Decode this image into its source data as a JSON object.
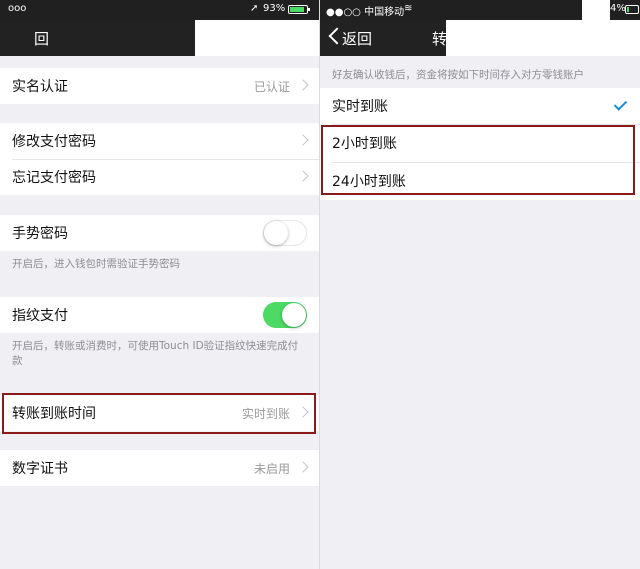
{
  "left": {
    "status": {
      "carrier": "ooo",
      "battery": "93%"
    },
    "nav": {
      "back_label": "回"
    },
    "rows": {
      "realname": {
        "title": "实名认证",
        "value": "已认证"
      },
      "change_pwd": {
        "title": "修改支付密码"
      },
      "forgot_pwd": {
        "title": "忘记支付密码"
      },
      "gesture": {
        "title": "手势密码",
        "on": false,
        "note": "开启后，进入钱包时需验证手势密码"
      },
      "fingerprint": {
        "title": "指纹支付",
        "on": true,
        "note": "开启后，转账或消费时，可使用Touch ID验证指纹快速完成付款"
      },
      "transfer_time": {
        "title": "转账到账时间",
        "value": "实时到账"
      },
      "certificate": {
        "title": "数字证书",
        "value": "未启用"
      }
    }
  },
  "right": {
    "status": {
      "carrier": "●●○○ 中国移动",
      "battery": "4%"
    },
    "nav": {
      "back_label": "返回",
      "title_partial": "转"
    },
    "header_note": "好友确认收钱后，资金将按如下时间存入对方零钱账户",
    "options": [
      {
        "label": "实时到账",
        "selected": true
      },
      {
        "label": "2小时到账",
        "selected": false
      },
      {
        "label": "24小时到账",
        "selected": false
      }
    ]
  },
  "colors": {
    "toggle_on": "#4cd964",
    "highlight_border": "#8b1a1a",
    "checkmark": "#1b8ad6"
  }
}
